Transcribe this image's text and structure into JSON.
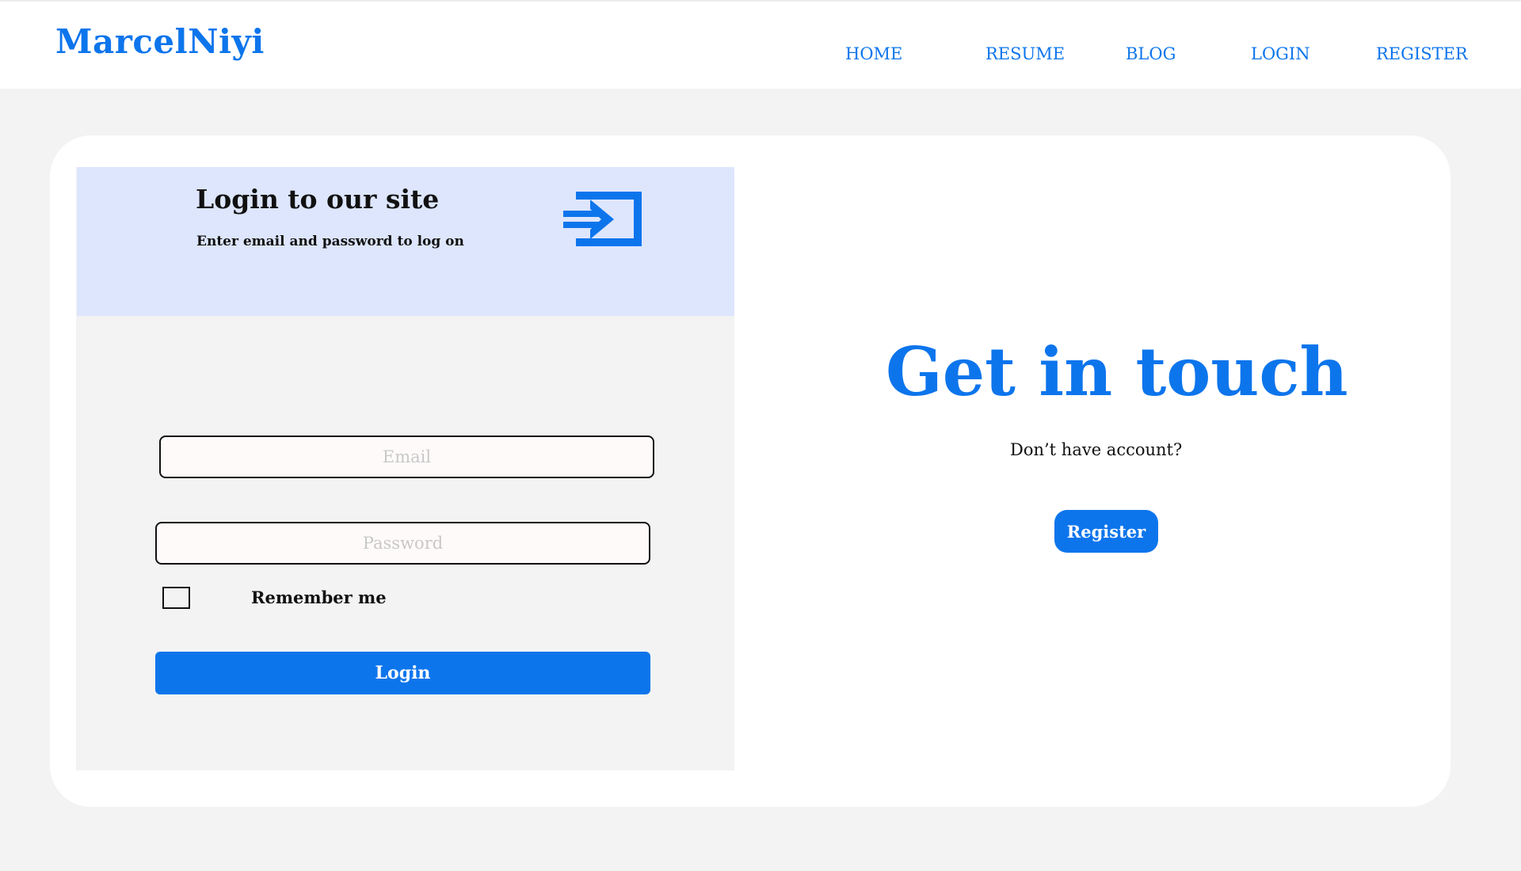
{
  "header": {
    "brand": "MarcelNiyi",
    "nav": [
      "HOME",
      "RESUME",
      "BLOG",
      "LOGIN",
      "REGISTER"
    ]
  },
  "login": {
    "title": "Login to our site",
    "subtitle": "Enter email and password to log on",
    "icon": "sign-in-icon",
    "email_placeholder": "Email",
    "password_placeholder": "Password",
    "remember_label": "Remember me",
    "login_button": "Login"
  },
  "contact": {
    "heading": "Get in touch",
    "prompt": "Don’t have account?",
    "register_button": "Register"
  },
  "colors": {
    "accent": "#0d75ec",
    "header_panel": "#dde6fd",
    "page_bg": "#f3f3f3"
  }
}
